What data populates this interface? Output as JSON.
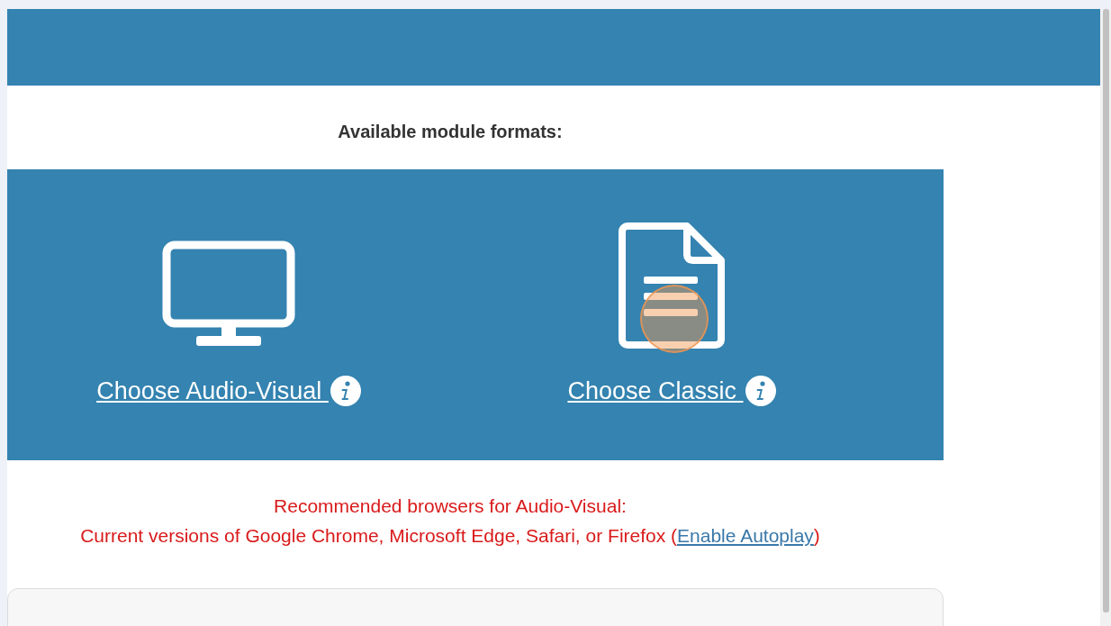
{
  "heading": "Available module formats:",
  "options": [
    {
      "kind": "monitor",
      "label": "Choose Audio-Visual "
    },
    {
      "kind": "document",
      "label": "Choose Classic "
    }
  ],
  "browsers_note": {
    "title": "Recommended browsers for Audio-Visual:",
    "text_before": "Current versions of Google Chrome, Microsoft Edge, Safari, or Firefox (",
    "link": "Enable Autoplay",
    "text_after": ")"
  }
}
